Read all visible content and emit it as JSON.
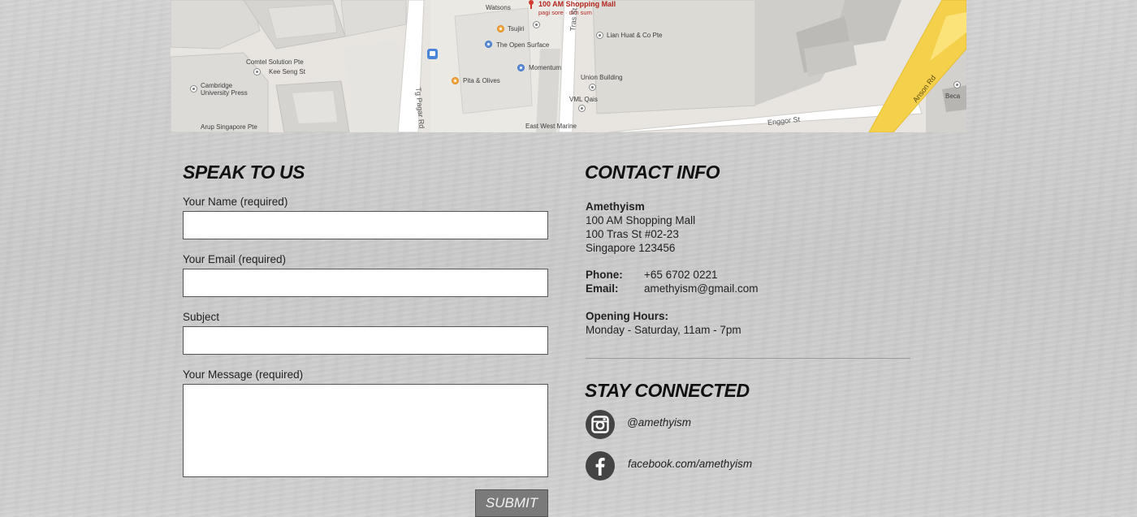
{
  "map": {
    "labels": {
      "watsons": "Watsons",
      "mall_name": "100 AM Shopping Mall",
      "mall_sub": "pagi sore · dim sum",
      "tsujiri": "Tsujiri",
      "open_surface": "The Open Surface",
      "tras_st": "Tras St",
      "lian_huat": "Lian Huat & Co Pte",
      "comtel": "Comtel Solution Pte",
      "kee_seng": "Kee Seng St",
      "cambridge_1": "Cambridge",
      "cambridge_2": "University Press",
      "momentum": "Momentum",
      "pita": "Pita & Olives",
      "union": "Union Building",
      "vml": "VML Qais",
      "tg_pagar": "Tg Pagar Rd",
      "arup": "Arup Singapore Pte",
      "east_west": "East West Marine",
      "enggor": "Enggor St",
      "anson": "Anson Rd",
      "beca": "Beca"
    }
  },
  "form": {
    "title": "SPEAK TO US",
    "name_label": "Your Name (required)",
    "email_label": "Your Email (required)",
    "subject_label": "Subject",
    "message_label": "Your Message (required)",
    "name_value": "",
    "email_value": "",
    "subject_value": "",
    "message_value": "",
    "submit_label": "SUBMIT"
  },
  "contact": {
    "title": "CONTACT INFO",
    "company": "Amethyism",
    "address_line1": "100 AM Shopping Mall",
    "address_line2": "100 Tras St #02-23",
    "address_line3": "Singapore 123456",
    "phone_label": "Phone:",
    "phone_value": "+65 6702 0221",
    "email_label": "Email:",
    "email_value": "amethyism@gmail.com",
    "hours_label": "Opening Hours:",
    "hours_value": "Monday - Saturday, 11am - 7pm"
  },
  "social": {
    "title": "STAY CONNECTED",
    "instagram": "@amethyism",
    "facebook": "facebook.com/amethyism"
  }
}
